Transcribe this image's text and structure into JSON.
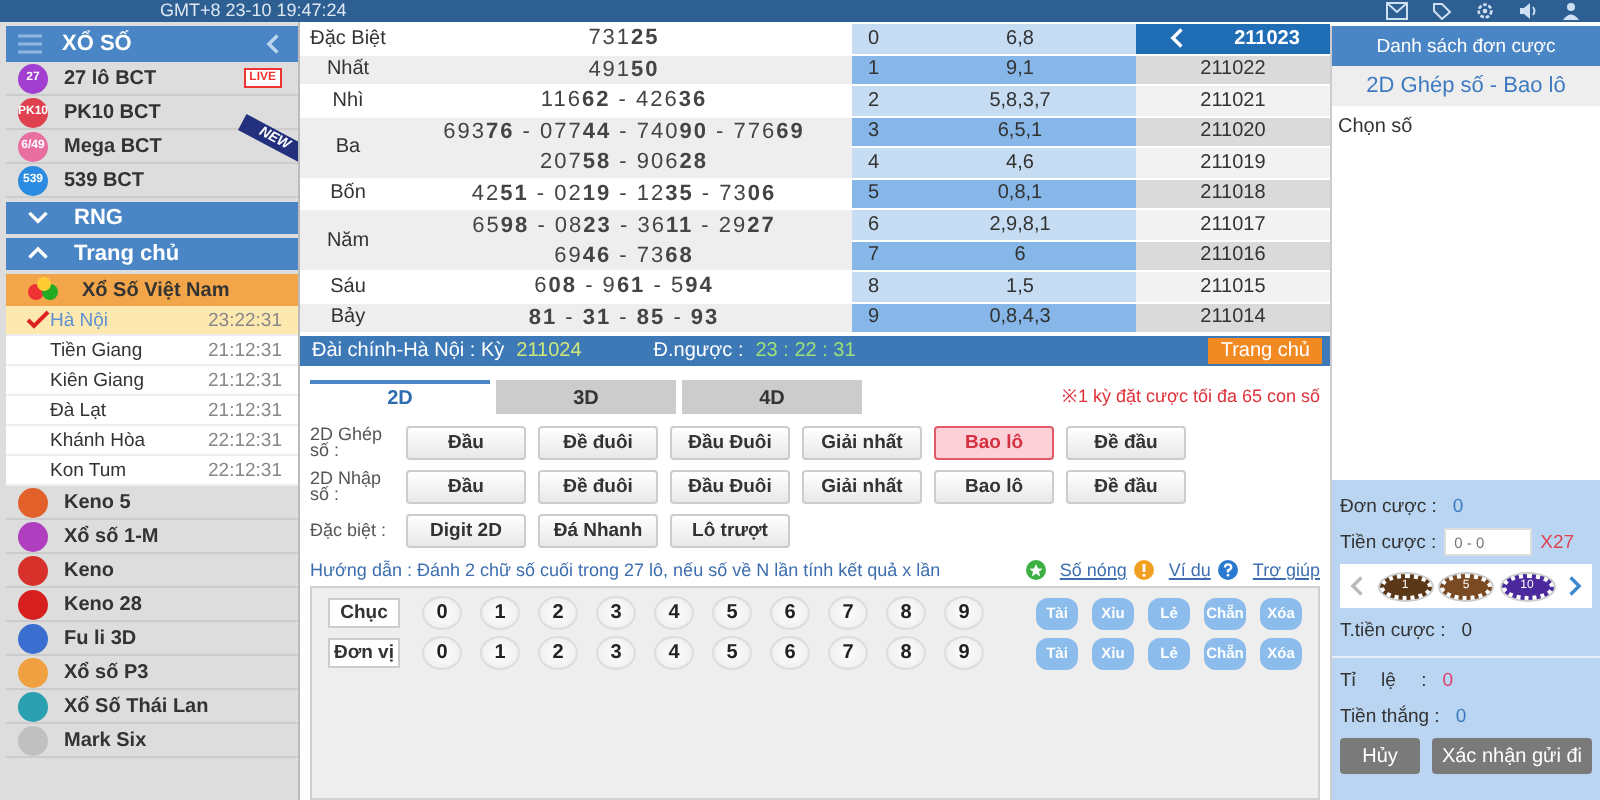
{
  "top_bar": {
    "clock": "GMT+8 23-10 19:47:24"
  },
  "sidebar": {
    "title": "XỔ SỐ",
    "items": [
      {
        "kind": "game",
        "label": "27 lô BCT",
        "icon_text": "27",
        "color": "#a23fd0",
        "badge": "LIVE"
      },
      {
        "kind": "game",
        "label": "PK10 BCT",
        "icon_text": "PK10",
        "color": "#e0414f"
      },
      {
        "kind": "game",
        "label": "Mega BCT",
        "icon_text": "6/49",
        "color": "#e86fa0",
        "ribbon": "NEW"
      },
      {
        "kind": "game",
        "label": "539 BCT",
        "icon_text": "539",
        "color": "#2b8be0"
      },
      {
        "kind": "section",
        "label": "RNG",
        "expanded": false
      },
      {
        "kind": "section",
        "label": "Trang chủ",
        "expanded": true
      },
      {
        "kind": "group",
        "label": "Xổ Số Việt Nam"
      },
      {
        "kind": "region",
        "label": "Hà Nội",
        "time": "23:22:31",
        "selected": true
      },
      {
        "kind": "region",
        "label": "Tiền Giang",
        "time": "21:12:31",
        "selected": false
      },
      {
        "kind": "region",
        "label": "Kiên Giang",
        "time": "21:12:31",
        "selected": false
      },
      {
        "kind": "region",
        "label": "Đà Lạt",
        "time": "21:12:31",
        "selected": false
      },
      {
        "kind": "region",
        "label": "Khánh Hòa",
        "time": "22:12:31",
        "selected": false
      },
      {
        "kind": "region",
        "label": "Kon Tum",
        "time": "22:12:31",
        "selected": false
      },
      {
        "kind": "game",
        "label": "Keno 5",
        "color": "#e2612b"
      },
      {
        "kind": "game",
        "label": "Xổ số 1-M",
        "color": "#b03fc0"
      },
      {
        "kind": "game",
        "label": "Keno",
        "color": "#d8302a"
      },
      {
        "kind": "game",
        "label": "Keno 28",
        "color": "#d62020"
      },
      {
        "kind": "game",
        "label": "Fu li 3D",
        "color": "#3a6fd0"
      },
      {
        "kind": "game",
        "label": "Xổ số P3",
        "color": "#f0a040"
      },
      {
        "kind": "game",
        "label": "Xổ Số Thái Lan",
        "color": "#2aa0b0"
      },
      {
        "kind": "game",
        "label": "Mark Six",
        "color": "#c0c0c0"
      }
    ]
  },
  "results": {
    "prizes": [
      {
        "name": "Đặc Biệt",
        "lines": [
          "731**25**"
        ]
      },
      {
        "name": "Nhất",
        "lines": [
          "491**50**"
        ]
      },
      {
        "name": "Nhì",
        "lines": [
          "116**62** - 426**36**"
        ]
      },
      {
        "name": "Ba",
        "lines": [
          "693**76** - 077**44** - 740**90** - 776**69**",
          "207**58** - 906**28**"
        ]
      },
      {
        "name": "Bốn",
        "lines": [
          "42**51** - 02**19** - 12**35** - 73**06**"
        ]
      },
      {
        "name": "Năm",
        "lines": [
          "65**98** - 08**23** - 36**11** - 29**27**",
          "69**46** - 73**68**"
        ]
      },
      {
        "name": "Sáu",
        "lines": [
          "6**08** - 9**61** - 5**94**"
        ]
      },
      {
        "name": "Bảy",
        "lines": [
          "**81** - **31** - **85** - **93**"
        ]
      }
    ],
    "heads": [
      {
        "digit": "0",
        "tails": "6,8"
      },
      {
        "digit": "1",
        "tails": "9,1"
      },
      {
        "digit": "2",
        "tails": "5,8,3,7"
      },
      {
        "digit": "3",
        "tails": "6,5,1"
      },
      {
        "digit": "4",
        "tails": "4,6"
      },
      {
        "digit": "5",
        "tails": "0,8,1"
      },
      {
        "digit": "6",
        "tails": "2,9,8,1"
      },
      {
        "digit": "7",
        "tails": "6"
      },
      {
        "digit": "8",
        "tails": "1,5"
      },
      {
        "digit": "9",
        "tails": "0,8,4,3"
      }
    ],
    "periods": [
      {
        "label": "211023",
        "selected": true
      },
      {
        "label": "211022",
        "selected": false
      },
      {
        "label": "211021",
        "selected": false
      },
      {
        "label": "211020",
        "selected": false
      },
      {
        "label": "211019",
        "selected": false
      },
      {
        "label": "211018",
        "selected": false
      },
      {
        "label": "211017",
        "selected": false
      },
      {
        "label": "211016",
        "selected": false
      },
      {
        "label": "211015",
        "selected": false
      },
      {
        "label": "211014",
        "selected": false
      }
    ]
  },
  "info_bar": {
    "draw_label": "Đài chính-Hà Nội : Kỳ",
    "draw_no": "211024",
    "countdown_label": "Đ.ngược :",
    "countdown": "23 : 22 : 31",
    "home_button": "Trang chủ"
  },
  "tabs": [
    {
      "label": "2D",
      "selected": true
    },
    {
      "label": "3D",
      "selected": false
    },
    {
      "label": "4D",
      "selected": false
    }
  ],
  "limit_note": "※1 kỳ đặt cược tối đa 65 con số",
  "bet_types": [
    {
      "label": "2D Ghép số :",
      "options": [
        {
          "label": "Đầu",
          "selected": false
        },
        {
          "label": "Đề đuôi",
          "selected": false
        },
        {
          "label": "Đầu Đuôi",
          "selected": false
        },
        {
          "label": "Giải nhất",
          "selected": false
        },
        {
          "label": "Bao lô",
          "selected": true
        },
        {
          "label": "Đề đầu",
          "selected": false
        }
      ]
    },
    {
      "label": "2D Nhập số :",
      "options": [
        {
          "label": "Đầu",
          "selected": false
        },
        {
          "label": "Đề đuôi",
          "selected": false
        },
        {
          "label": "Đầu Đuôi",
          "selected": false
        },
        {
          "label": "Giải nhất",
          "selected": false
        },
        {
          "label": "Bao lô",
          "selected": false
        },
        {
          "label": "Đề đầu",
          "selected": false
        }
      ]
    },
    {
      "label": "Đặc biệt :",
      "options": [
        {
          "label": "Digit 2D",
          "selected": false
        },
        {
          "label": "Đá Nhanh",
          "selected": false
        },
        {
          "label": "Lô trượt",
          "selected": false
        }
      ]
    }
  ],
  "guide": "Hướng dẫn : Đánh 2 chữ số cuối trong 27 lô, nếu số về N lần tính kết quả x lần",
  "guide_links": [
    {
      "kind": "hot",
      "label": "Số nóng"
    },
    {
      "kind": "example",
      "label": "Ví dụ"
    },
    {
      "kind": "help",
      "label": "Trợ giúp"
    }
  ],
  "number_rows": [
    {
      "label": "Chục",
      "digits": [
        "0",
        "1",
        "2",
        "3",
        "4",
        "5",
        "6",
        "7",
        "8",
        "9"
      ],
      "quick": [
        "Tài",
        "Xỉu",
        "Lẻ",
        "Chẵn",
        "Xóa"
      ]
    },
    {
      "label": "Đơn vị",
      "digits": [
        "0",
        "1",
        "2",
        "3",
        "4",
        "5",
        "6",
        "7",
        "8",
        "9"
      ],
      "quick": [
        "Tài",
        "Xỉu",
        "Lẻ",
        "Chẵn",
        "Xóa"
      ]
    }
  ],
  "bet_slip": {
    "title": "Danh sách đơn cược",
    "subtitle": "2D Ghép số - Bao lô",
    "prompt": "Chọn số",
    "orders_label": "Đơn cược :",
    "orders_value": "0",
    "stake_label": "Tiền cược :",
    "stake_placeholder": "0 - 0",
    "multiplier": "X27",
    "chips": [
      {
        "value": "1",
        "color": "#5a3818"
      },
      {
        "value": "5",
        "color": "#7a4a22"
      },
      {
        "value": "10",
        "color": "#4a2a9c"
      }
    ],
    "total_label": "T.tiền cược :",
    "total_value": "0",
    "rate_label": "Tỉ lệ :",
    "rate_value": "0",
    "win_label": "Tiền thắng :",
    "win_value": "0",
    "buttons": [
      "Hủy",
      "Xác nhận gửi đi"
    ]
  }
}
